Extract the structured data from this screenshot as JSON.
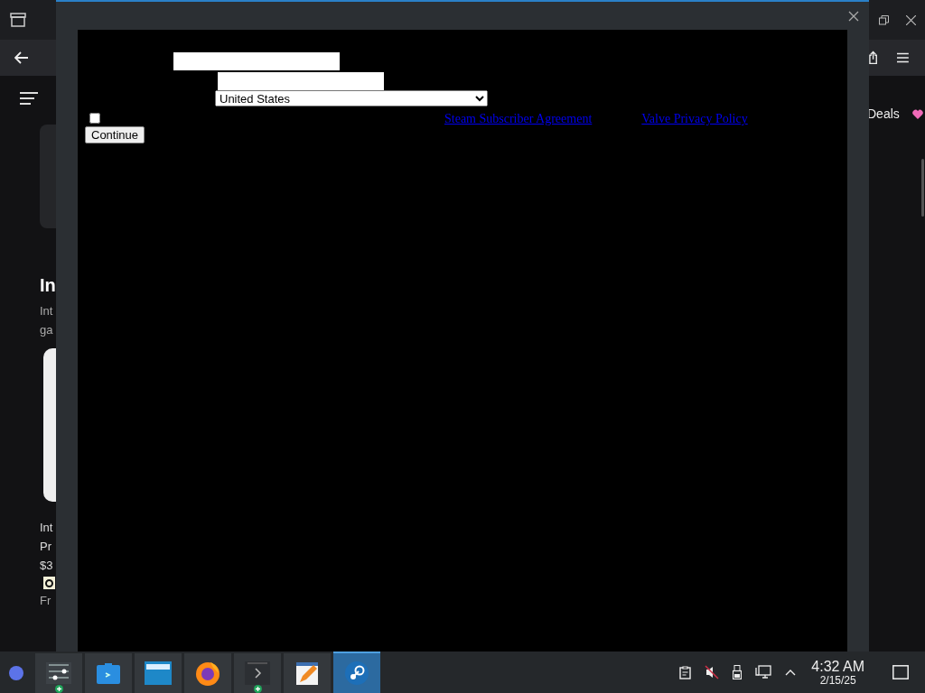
{
  "browser": {
    "left_heading": "In",
    "left_lines": [
      "Int",
      "ga"
    ],
    "left_product": [
      "Int",
      "Pr"
    ],
    "left_price": "$3",
    "left_shipping": "Fr",
    "right_link": "Deals"
  },
  "dialog": {
    "country": "United States",
    "agree": {
      "checked": false
    },
    "links": [
      "Steam Subscriber Agreement",
      "Valve Privacy Policy"
    ],
    "button": "Continue"
  },
  "taskbar": {
    "apps": [
      {
        "kind": "launcher",
        "selected": false,
        "badge": false
      },
      {
        "kind": "sliders",
        "selected": false,
        "badge": true
      },
      {
        "kind": "store",
        "selected": false,
        "badge": false
      },
      {
        "kind": "folder",
        "selected": false,
        "badge": false
      },
      {
        "kind": "browser",
        "selected": false,
        "badge": false
      },
      {
        "kind": "terminal",
        "selected": false,
        "badge": true
      },
      {
        "kind": "editor",
        "selected": false,
        "badge": false
      },
      {
        "kind": "steam",
        "selected": true,
        "badge": false
      }
    ],
    "time": "4:32 AM",
    "date": "2/15/25"
  }
}
